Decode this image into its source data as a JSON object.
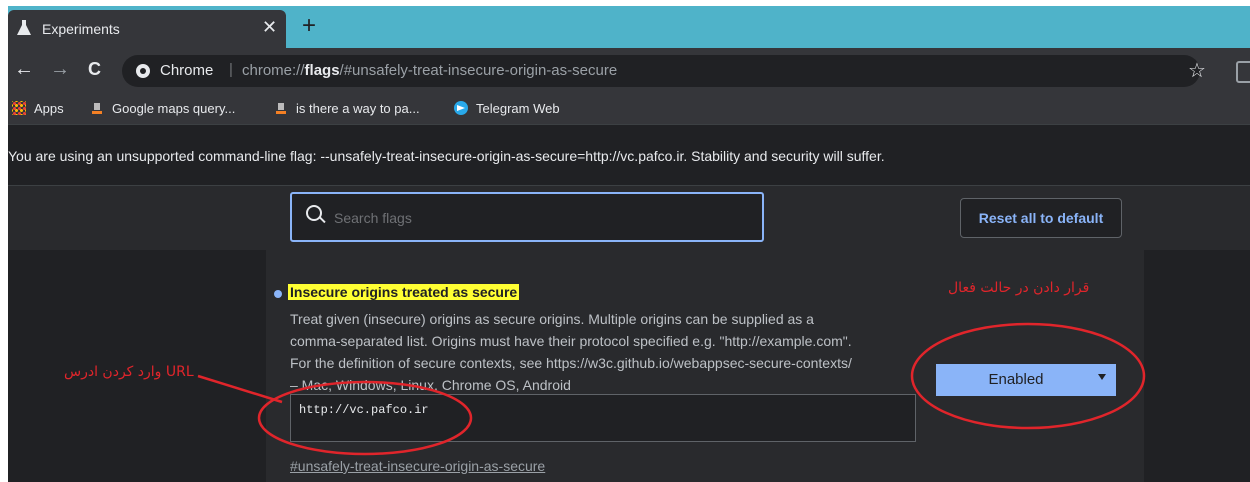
{
  "tab": {
    "title": "Experiments",
    "icon": "flask-icon",
    "close_label": "✕"
  },
  "new_tab_label": "+",
  "toolbar": {
    "back": "←",
    "forward": "→",
    "reload": "C",
    "chip": "Chrome",
    "separator": "|",
    "url_prefix": "chrome://",
    "url_bold": "flags",
    "url_suffix": "/#unsafely-treat-insecure-origin-as-secure",
    "star": "☆"
  },
  "bookmarks": [
    {
      "label": "Apps",
      "icon": "apps-grid-icon"
    },
    {
      "label": "Google maps query...",
      "icon": "stackoverflow-icon"
    },
    {
      "label": "is there a way to pa...",
      "icon": "stackoverflow-icon"
    },
    {
      "label": "Telegram Web",
      "icon": "telegram-icon"
    }
  ],
  "warning": "You are using an unsupported command-line flag: --unsafely-treat-insecure-origin-as-secure=http://vc.pafco.ir. Stability and security will suffer.",
  "search": {
    "placeholder": "Search flags"
  },
  "reset_label": "Reset all to default",
  "flag": {
    "title": "Insecure origins treated as secure",
    "desc_lines": [
      "Treat given (insecure) origins as secure origins. Multiple origins can be supplied as a",
      "comma-separated list. Origins must have their protocol specified e.g. \"http://example.com\".",
      "For the definition of secure contexts, see https://w3c.github.io/webappsec-secure-contexts/",
      "– Mac, Windows, Linux, Chrome OS, Android"
    ],
    "value": "http://vc.pafco.ir",
    "link": "#unsafely-treat-insecure-origin-as-secure",
    "selected": "Enabled"
  },
  "annotations": {
    "enable_text": "قرار دادن در حالت فعال",
    "url_text": "وارد کردن ادرس URL",
    "color": "#e0252b"
  }
}
